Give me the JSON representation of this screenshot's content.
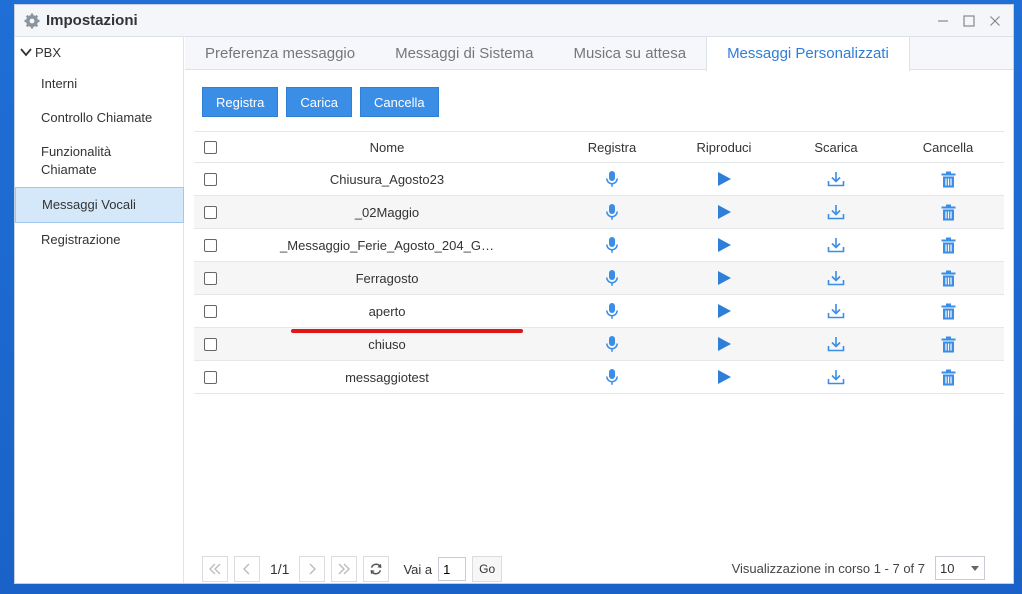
{
  "window": {
    "title": "Impostazioni"
  },
  "sidebar": {
    "root": "PBX",
    "items": [
      {
        "label": "Interni"
      },
      {
        "label": "Controllo Chiamate"
      },
      {
        "label": "Funzionalità Chiamate"
      },
      {
        "label": "Messaggi Vocali"
      },
      {
        "label": "Registrazione"
      }
    ]
  },
  "tabs": [
    {
      "label": "Preferenza messaggio"
    },
    {
      "label": "Messaggi di Sistema"
    },
    {
      "label": "Musica su attesa"
    },
    {
      "label": "Messaggi Personalizzati"
    }
  ],
  "toolbar": {
    "record": "Registra",
    "upload": "Carica",
    "delete": "Cancella"
  },
  "table": {
    "headers": {
      "name": "Nome",
      "record": "Registra",
      "play": "Riproduci",
      "download": "Scarica",
      "delete": "Cancella"
    },
    "rows": [
      {
        "name": "Chiusura_Agosto23"
      },
      {
        "name": "_02Maggio"
      },
      {
        "name": "_Messaggio_Ferie_Agosto_204_G…"
      },
      {
        "name": "Ferragosto"
      },
      {
        "name": "aperto"
      },
      {
        "name": "chiuso"
      },
      {
        "name": "messaggiotest"
      }
    ]
  },
  "pager": {
    "page_text": "1/1",
    "goto_label": "Vai a",
    "goto_value": "1",
    "go_label": "Go",
    "info": "Visualizzazione in corso 1 - 7 of 7",
    "page_size": "10"
  },
  "colors": {
    "accent": "#3a8ee6",
    "highlight": "#e01515",
    "active_nav": "#d4e8fa"
  },
  "icons": {
    "title": "gear-icon",
    "record": "microphone-icon",
    "play": "play-icon",
    "download": "download-icon",
    "delete": "trash-icon"
  }
}
